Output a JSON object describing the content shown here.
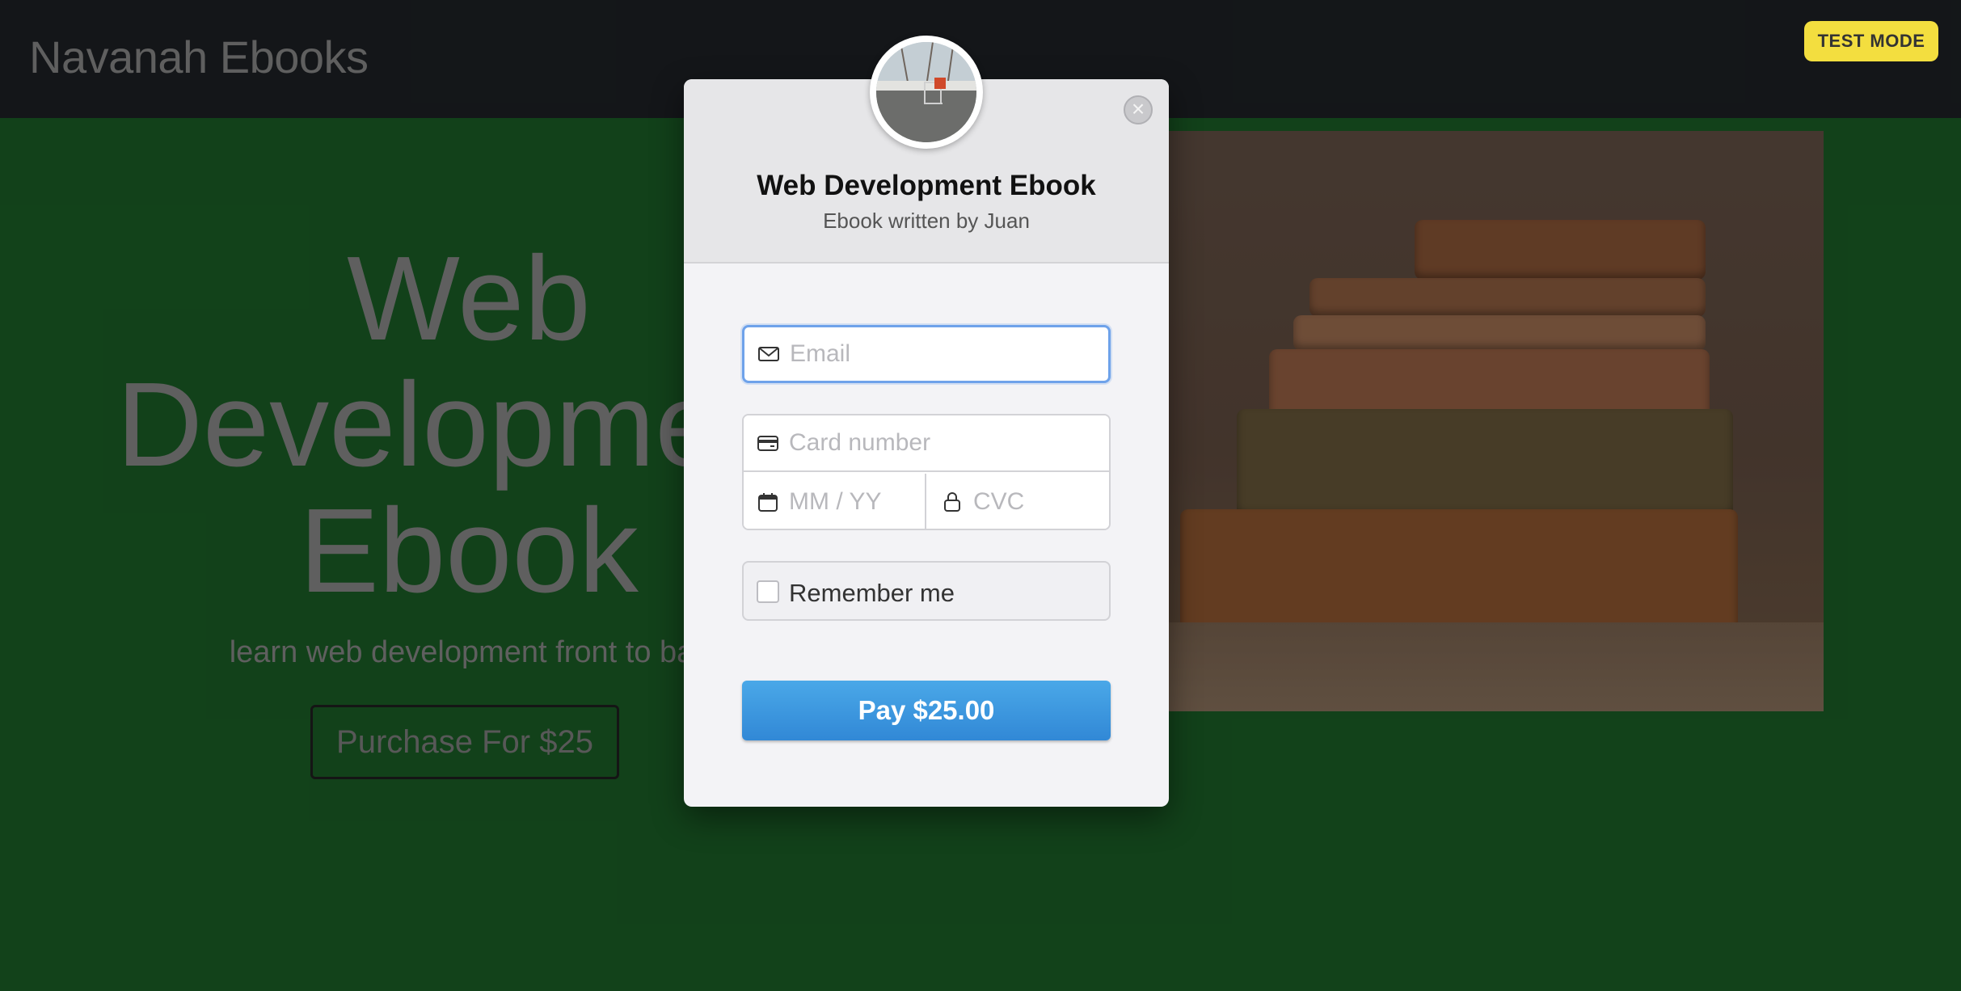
{
  "navbar": {
    "brand": "Navanah Ebooks"
  },
  "hero": {
    "title": "Web\nDevelopment\nEbook",
    "subtitle": "learn web development front to back",
    "purchase_label": "Purchase For $25"
  },
  "badge": {
    "label": "TEST MODE",
    "color": "#f3de3f"
  },
  "modal": {
    "title": "Web Development Ebook",
    "subtitle": "Ebook written by Juan",
    "close_icon": "close-icon",
    "email": {
      "value": "",
      "placeholder": "Email",
      "icon": "envelope-icon"
    },
    "card": {
      "number": {
        "value": "",
        "placeholder": "Card number",
        "icon": "credit-card-icon"
      },
      "expiry": {
        "value": "",
        "placeholder": "MM / YY",
        "icon": "calendar-icon"
      },
      "cvc": {
        "value": "",
        "placeholder": "CVC",
        "icon": "lock-icon"
      }
    },
    "remember": {
      "label": "Remember me",
      "checked": false
    },
    "pay_label": "Pay $25.00",
    "pay_color": "#3a96de"
  },
  "colors": {
    "page_bg": "#1d6a2a",
    "navbar_bg": "#212529",
    "focus_border": "#6ea2ea"
  }
}
